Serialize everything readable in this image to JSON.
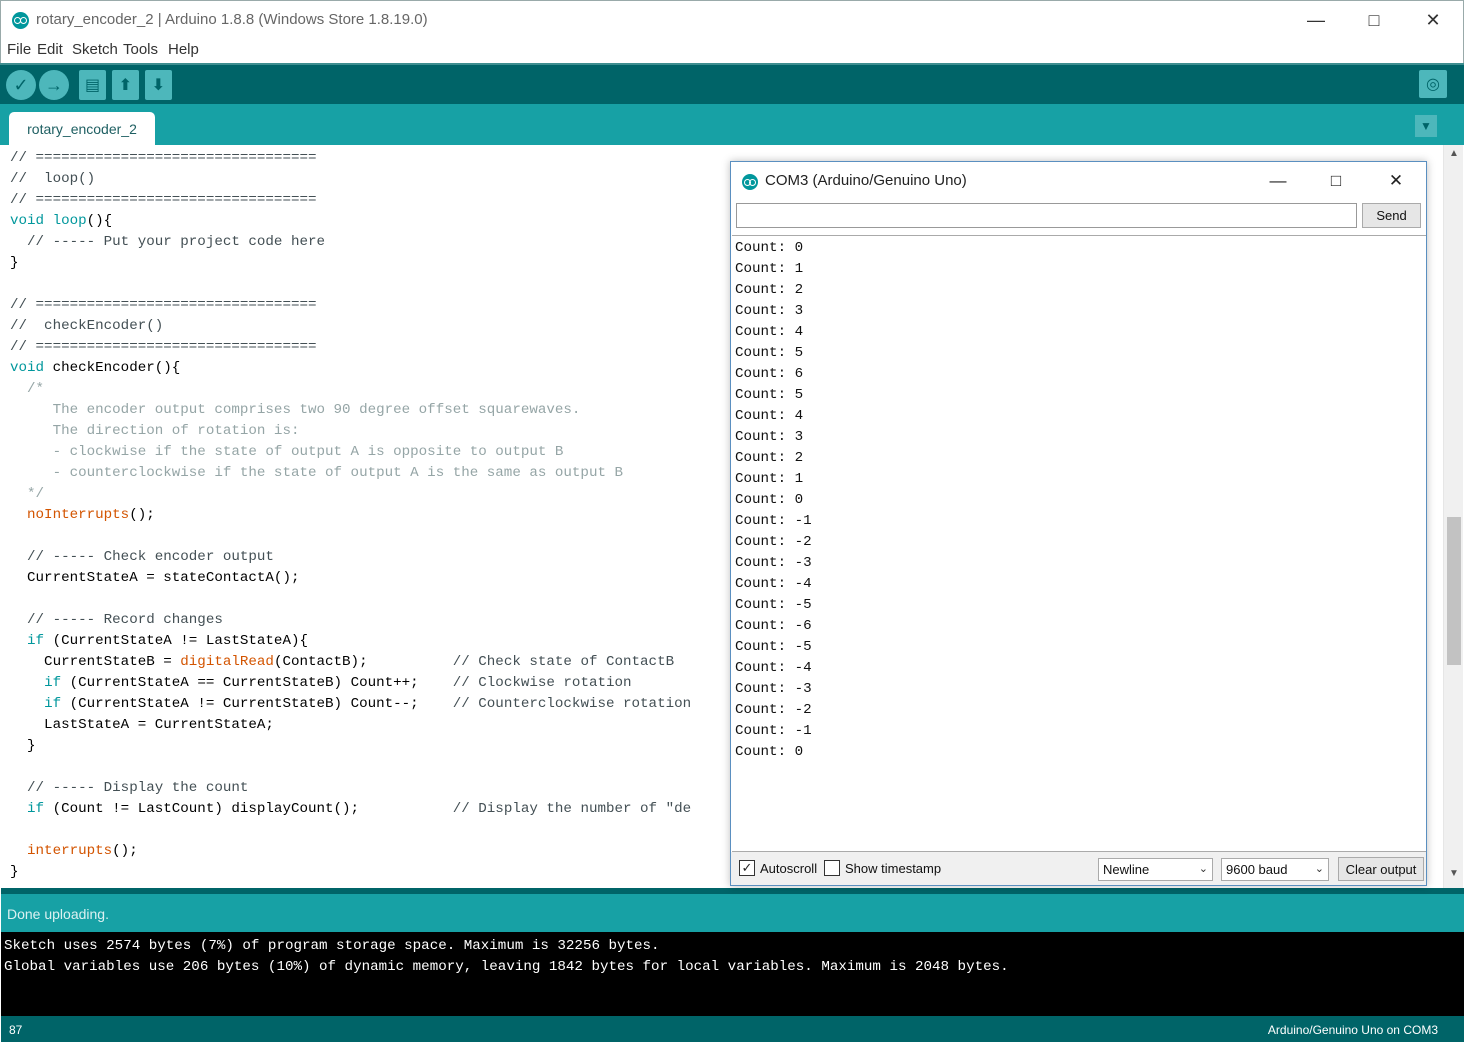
{
  "window": {
    "title": "rotary_encoder_2 | Arduino 1.8.8 (Windows Store 1.8.19.0)",
    "minimize": "—",
    "maximize": "□",
    "close": "✕"
  },
  "menu": [
    "File",
    "Edit",
    "Sketch",
    "Tools",
    "Help"
  ],
  "toolbar": {
    "verify_icon": "check-icon",
    "upload_icon": "arrow-right-icon",
    "new_icon": "new-file-icon",
    "open_icon": "open-icon",
    "save_icon": "save-icon",
    "serial_icon": "magnifier-icon",
    "verify_glyph": "✓",
    "upload_glyph": "→",
    "new_glyph": "▤",
    "open_glyph": "⬆",
    "save_glyph": "⬇",
    "serial_glyph": "◎"
  },
  "tabs": {
    "active": "rotary_encoder_2",
    "menu_glyph": "▼"
  },
  "code": [
    [
      [
        "c-comment",
        "// ================================="
      ]
    ],
    [
      [
        "c-comment",
        "//  loop()"
      ]
    ],
    [
      [
        "c-comment",
        "// ================================="
      ]
    ],
    [
      [
        "c-kw",
        "void"
      ],
      [
        "c-plain",
        " "
      ],
      [
        "c-kw",
        "loop"
      ],
      [
        "c-plain",
        "(){"
      ]
    ],
    [
      [
        "c-comment",
        "  // ----- Put your project code here"
      ]
    ],
    [
      [
        "c-plain",
        "}"
      ]
    ],
    [
      [
        "c-plain",
        ""
      ]
    ],
    [
      [
        "c-comment",
        "// ================================="
      ]
    ],
    [
      [
        "c-comment",
        "//  checkEncoder()"
      ]
    ],
    [
      [
        "c-comment",
        "// ================================="
      ]
    ],
    [
      [
        "c-kw",
        "void"
      ],
      [
        "c-plain",
        " checkEncoder(){"
      ]
    ],
    [
      [
        "c-doc",
        "  /*"
      ]
    ],
    [
      [
        "c-doc",
        "     The encoder output comprises two 90 degree offset squarewaves."
      ]
    ],
    [
      [
        "c-doc",
        "     The direction of rotation is:"
      ]
    ],
    [
      [
        "c-doc",
        "     - clockwise if the state of output A is opposite to output B"
      ]
    ],
    [
      [
        "c-doc",
        "     - counterclockwise if the state of output A is the same as output B"
      ]
    ],
    [
      [
        "c-doc",
        "  */"
      ]
    ],
    [
      [
        "c-plain",
        "  "
      ],
      [
        "c-fn",
        "noInterrupts"
      ],
      [
        "c-plain",
        "();"
      ]
    ],
    [
      [
        "c-plain",
        ""
      ]
    ],
    [
      [
        "c-comment",
        "  // ----- Check encoder output"
      ]
    ],
    [
      [
        "c-plain",
        "  CurrentStateA = stateContactA();"
      ]
    ],
    [
      [
        "c-plain",
        ""
      ]
    ],
    [
      [
        "c-comment",
        "  // ----- Record changes"
      ]
    ],
    [
      [
        "c-plain",
        "  "
      ],
      [
        "c-kw",
        "if"
      ],
      [
        "c-plain",
        " (CurrentStateA != LastStateA){"
      ]
    ],
    [
      [
        "c-plain",
        "    CurrentStateB = "
      ],
      [
        "c-fn",
        "digitalRead"
      ],
      [
        "c-plain",
        "(ContactB);          "
      ],
      [
        "c-comment",
        "// Check state of ContactB"
      ]
    ],
    [
      [
        "c-plain",
        "    "
      ],
      [
        "c-kw",
        "if"
      ],
      [
        "c-plain",
        " (CurrentStateA == CurrentStateB) Count++;    "
      ],
      [
        "c-comment",
        "// Clockwise rotation"
      ]
    ],
    [
      [
        "c-plain",
        "    "
      ],
      [
        "c-kw",
        "if"
      ],
      [
        "c-plain",
        " (CurrentStateA != CurrentStateB) Count--;    "
      ],
      [
        "c-comment",
        "// Counterclockwise rotation"
      ]
    ],
    [
      [
        "c-plain",
        "    LastStateA = CurrentStateA;"
      ]
    ],
    [
      [
        "c-plain",
        "  }"
      ]
    ],
    [
      [
        "c-plain",
        ""
      ]
    ],
    [
      [
        "c-comment",
        "  // ----- Display the count"
      ]
    ],
    [
      [
        "c-plain",
        "  "
      ],
      [
        "c-kw",
        "if"
      ],
      [
        "c-plain",
        " (Count != LastCount) displayCount();           "
      ],
      [
        "c-comment",
        "// Display the number of \"de"
      ]
    ],
    [
      [
        "c-plain",
        ""
      ]
    ],
    [
      [
        "c-plain",
        "  "
      ],
      [
        "c-fn",
        "interrupts"
      ],
      [
        "c-plain",
        "();"
      ]
    ],
    [
      [
        "c-plain",
        "}"
      ]
    ]
  ],
  "editor_scroll": {
    "up_glyph": "▲",
    "down_glyph": "▼"
  },
  "status": {
    "message": "Done uploading."
  },
  "console": [
    "Sketch uses 2574 bytes (7%) of program storage space. Maximum is 32256 bytes.",
    "Global variables use 206 bytes (10%) of dynamic memory, leaving 1842 bytes for local variables. Maximum is 2048 bytes."
  ],
  "footer": {
    "line_number": "87",
    "board": "Arduino/Genuino Uno on COM3"
  },
  "serial_monitor": {
    "title": "COM3 (Arduino/Genuino Uno)",
    "minimize": "—",
    "maximize": "□",
    "close": "✕",
    "input_value": "",
    "send_label": "Send",
    "output": [
      "Count: 0",
      "Count: 1",
      "Count: 2",
      "Count: 3",
      "Count: 4",
      "Count: 5",
      "Count: 6",
      "Count: 5",
      "Count: 4",
      "Count: 3",
      "Count: 2",
      "Count: 1",
      "Count: 0",
      "Count: -1",
      "Count: -2",
      "Count: -3",
      "Count: -4",
      "Count: -5",
      "Count: -6",
      "Count: -5",
      "Count: -4",
      "Count: -3",
      "Count: -2",
      "Count: -1",
      "Count: 0"
    ],
    "autoscroll_label": "Autoscroll",
    "autoscroll_checked": true,
    "autoscroll_mark": "✓",
    "timestamp_label": "Show timestamp",
    "timestamp_checked": false,
    "line_ending": "Newline",
    "baud": "9600 baud",
    "dropdown_glyph": "⌄",
    "clear_label": "Clear output"
  },
  "colors": {
    "teal_dark": "#006468",
    "teal": "#17a1a5",
    "teal_light": "#4db7bb",
    "keyword": "#00979c",
    "function": "#d35400"
  }
}
